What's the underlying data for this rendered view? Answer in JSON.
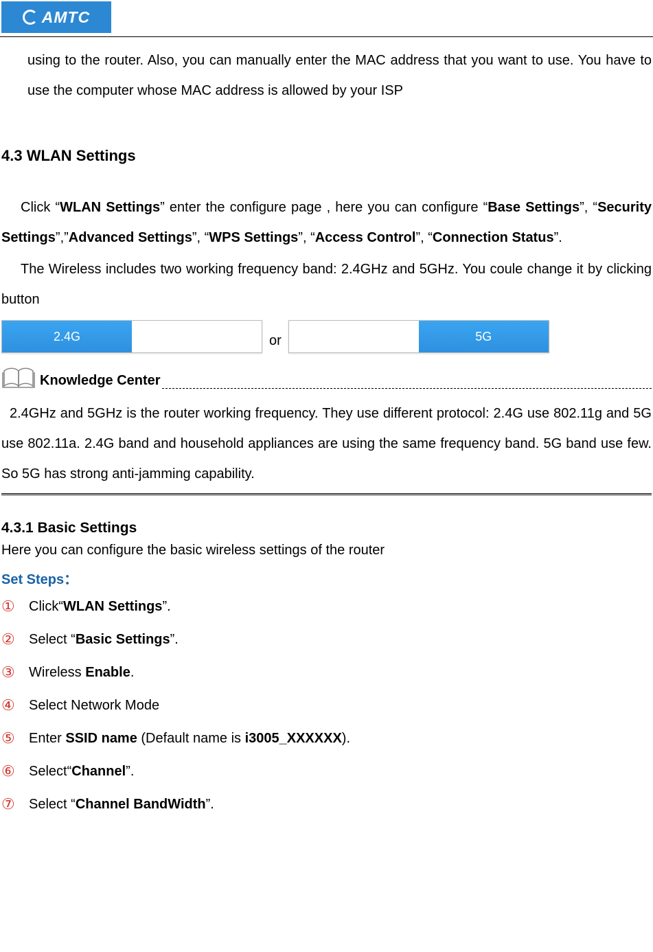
{
  "logo_text": "AMTC",
  "intro_para": "using to the router. Also, you can manually enter the MAC address that you want to use. You have to use the computer whose MAC address is allowed by your ISP",
  "h2": "4.3 WLAN Settings",
  "wlan_para": {
    "t1": "Click “",
    "b1": "WLAN Settings",
    "t2": "” enter the configure page , here you can configure “",
    "b2": "Base Settings",
    "t3": "”, “",
    "b3": "Security Settings",
    "t4": "”,”",
    "b4": "Advanced Settings",
    "t5": "”, “",
    "b5": "WPS Settings",
    "t6": "”, “",
    "b6": "Access Control",
    "t7": "”, “",
    "b7": "Connection Status",
    "t8": "”."
  },
  "freq_para": "The Wireless includes two working frequency band: 2.4GHz and 5GHz. You coule change it by clicking button",
  "band_a_left": "2.4G",
  "band_a_right": "",
  "or_text": "or",
  "band_b_left": "",
  "band_b_right": "5G",
  "kc_label": "Knowledge Center",
  "kc_body": "2.4GHz and 5GHz is the router working frequency. They use different protocol: 2.4G use 802.11g and 5G use 802.11a. 2.4G band and household appliances are using the same frequency band. 5G band use few. So 5G has strong anti-jamming capability.",
  "h3": "4.3.1 Basic Settings",
  "h3_sub": "Here you can configure the basic wireless settings of the router",
  "steps_hd": "Set Steps：",
  "steps": [
    {
      "n": "①",
      "pre": "Click“",
      "bold": "WLAN Settings",
      "post": "”."
    },
    {
      "n": "②",
      "pre": "Select “",
      "bold": "Basic Settings",
      "post": "”."
    },
    {
      "n": "③",
      "pre": "Wireless ",
      "bold": "Enable",
      "post": "."
    },
    {
      "n": "④",
      "pre": "Select Network Mode",
      "bold": "",
      "post": ""
    },
    {
      "n": "⑤",
      "pre": "Enter ",
      "bold": "SSID name",
      "mid": " (Default name is ",
      "bold2": "i3005_XXXXXX",
      "post": ")."
    },
    {
      "n": "⑥",
      "pre": "Select“",
      "bold": "Channel",
      "post": "”."
    },
    {
      "n": "⑦",
      "pre": "Select “",
      "bold": "Channel BandWidth",
      "post": "”."
    }
  ]
}
